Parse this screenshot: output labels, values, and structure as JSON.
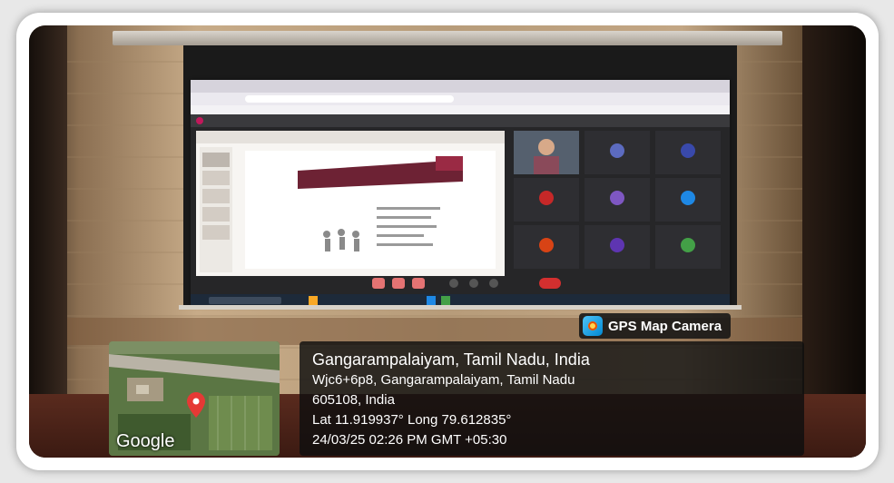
{
  "overlay": {
    "app_name": "GPS Map Camera",
    "map_brand": "Google",
    "location_title": "Gangarampalaiyam, Tamil Nadu, India",
    "address_line1": "Wjc6+6p8, Gangarampalaiyam, Tamil Nadu",
    "address_line2": "605108, India",
    "coordinates": "Lat 11.919937° Long 79.612835°",
    "timestamp": "24/03/25 02:26 PM GMT +05:30"
  },
  "colors": {
    "pin": "#e53935",
    "overlay_bg": "#0f0f0f",
    "wall": "#c7ab88",
    "floor": "#4a2218"
  },
  "icons": [
    "gps-map-camera-icon",
    "map-pin-icon"
  ]
}
